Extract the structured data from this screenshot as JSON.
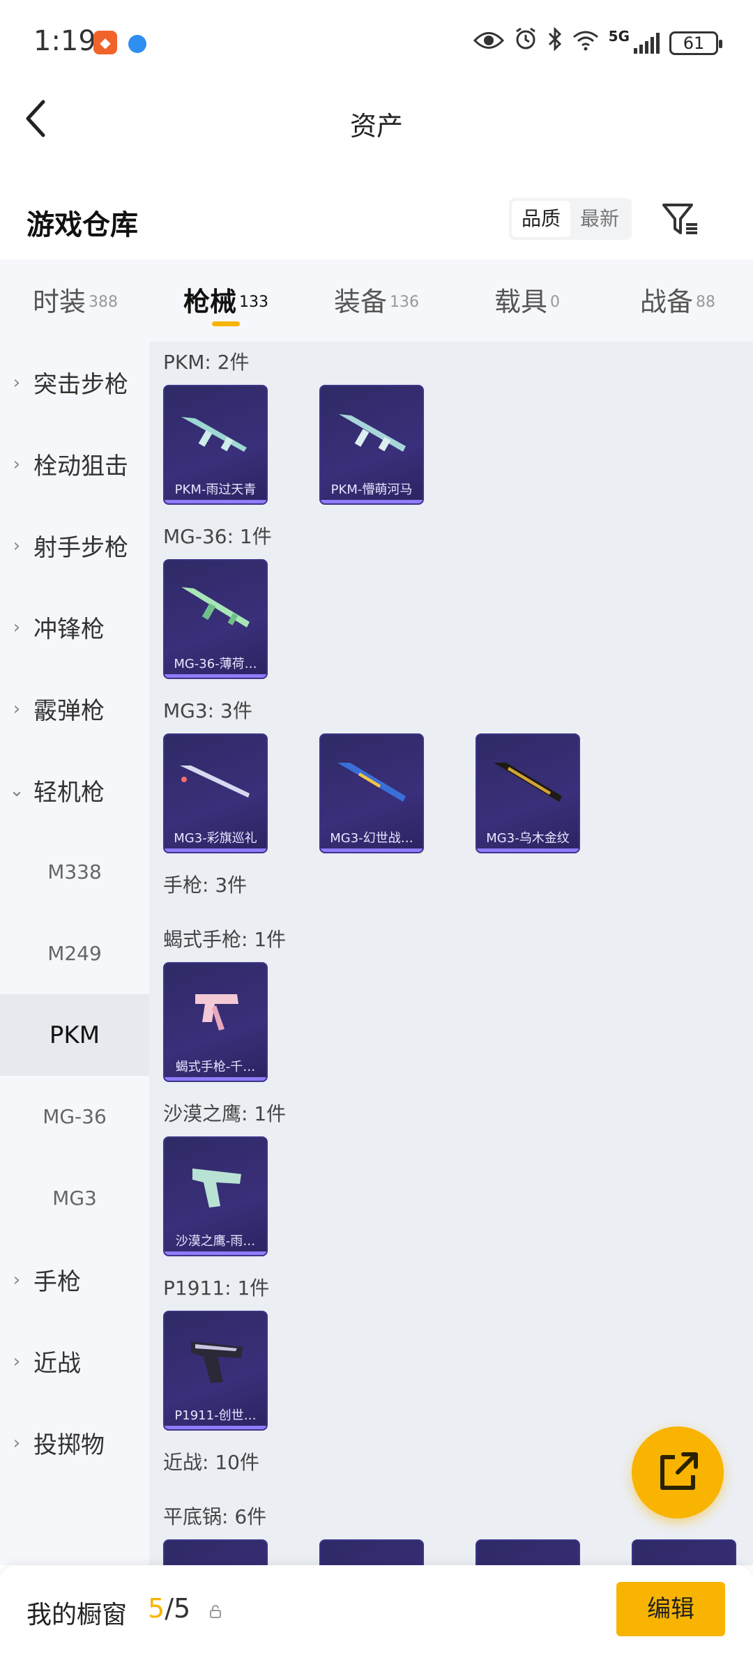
{
  "status_bar": {
    "time": "1:19",
    "network": "5G",
    "battery": "61"
  },
  "header": {
    "title": "资产"
  },
  "section": {
    "title": "游戏仓库",
    "sort_options": [
      "品质",
      "最新"
    ]
  },
  "tabs": [
    {
      "label": "时装",
      "count": "388"
    },
    {
      "label": "枪械",
      "count": "133"
    },
    {
      "label": "装备",
      "count": "136"
    },
    {
      "label": "载具",
      "count": "0"
    },
    {
      "label": "战备",
      "count": "88"
    }
  ],
  "sidebar": {
    "categories_top": [
      "突击步枪",
      "栓动狙击",
      "射手步枪",
      "冲锋枪",
      "霰弹枪",
      "轻机枪"
    ],
    "sub_items": [
      "M338",
      "M249",
      "PKM",
      "MG-36",
      "MG3"
    ],
    "categories_bottom": [
      "手枪",
      "近战",
      "投掷物"
    ]
  },
  "groups": [
    {
      "title": "PKM: 2件",
      "items": [
        "PKM-雨过天青",
        "PKM-懵萌河马"
      ]
    },
    {
      "title": "MG-36: 1件",
      "items": [
        "MG-36-薄荷…"
      ]
    },
    {
      "title": "MG3: 3件",
      "items": [
        "MG3-彩旗巡礼",
        "MG3-幻世战…",
        "MG3-乌木金纹"
      ]
    },
    {
      "title": "手枪: 3件",
      "items": []
    },
    {
      "title": "蝎式手枪: 1件",
      "items": [
        "蝎式手枪-千…"
      ]
    },
    {
      "title": "沙漠之鹰: 1件",
      "items": [
        "沙漠之鹰-雨…"
      ]
    },
    {
      "title": "P1911: 1件",
      "items": [
        "P1911-创世…"
      ]
    },
    {
      "title": "近战: 10件",
      "items": []
    },
    {
      "title": "平底锅: 6件",
      "items": []
    }
  ],
  "bottom_bar": {
    "label": "我的橱窗",
    "current": "5",
    "total": "/5",
    "edit": "编辑"
  },
  "colors": {
    "accent": "#f8b400",
    "card_bg": "#2f2a66"
  }
}
